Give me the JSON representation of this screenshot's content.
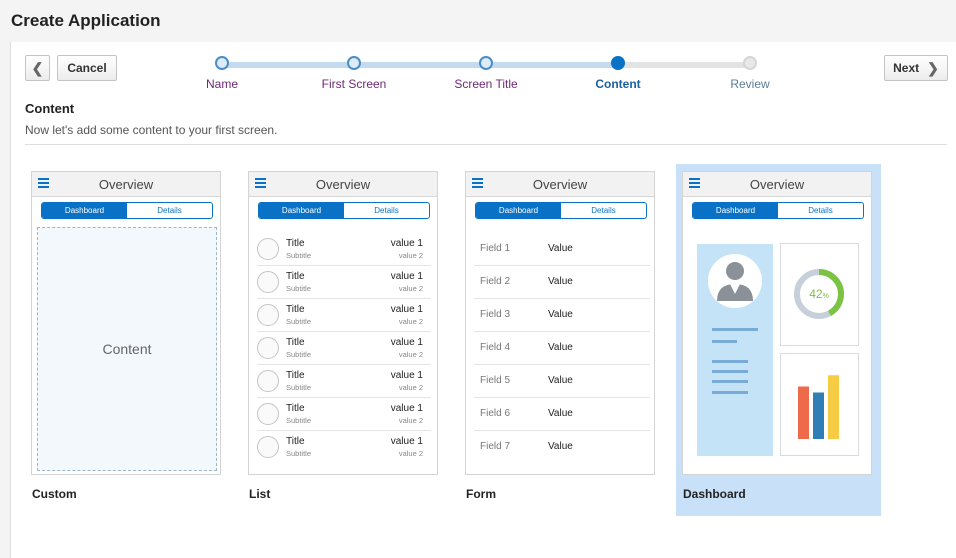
{
  "window": {
    "title": "Create Application"
  },
  "nav": {
    "cancel_label": "Cancel",
    "next_label": "Next",
    "prev_icon": "chevron-left-icon",
    "next_icon": "chevron-right-icon"
  },
  "train": {
    "stops": [
      {
        "label": "Name",
        "state": "visited"
      },
      {
        "label": "First Screen",
        "state": "visited"
      },
      {
        "label": "Screen Title",
        "state": "visited"
      },
      {
        "label": "Content",
        "state": "current"
      },
      {
        "label": "Review",
        "state": "future"
      }
    ]
  },
  "section": {
    "title": "Content",
    "description": "Now let's add some content to your first screen."
  },
  "preview": {
    "header_title": "Overview",
    "tab_primary": "Dashboard",
    "tab_secondary": "Details",
    "menu_icon": "hamburger-menu-icon"
  },
  "templates": [
    {
      "name": "Custom",
      "selected": false
    },
    {
      "name": "List",
      "selected": false
    },
    {
      "name": "Form",
      "selected": false
    },
    {
      "name": "Dashboard",
      "selected": true
    }
  ],
  "custom": {
    "placeholder": "Content"
  },
  "list_rows": [
    {
      "title": "Title",
      "subtitle": "Subtitle",
      "value1": "value 1",
      "value2": "value 2"
    },
    {
      "title": "Title",
      "subtitle": "Subtitle",
      "value1": "value 1",
      "value2": "value 2"
    },
    {
      "title": "Title",
      "subtitle": "Subtitle",
      "value1": "value 1",
      "value2": "value 2"
    },
    {
      "title": "Title",
      "subtitle": "Subtitle",
      "value1": "value 1",
      "value2": "value 2"
    },
    {
      "title": "Title",
      "subtitle": "Subtitle",
      "value1": "value 1",
      "value2": "value 2"
    },
    {
      "title": "Title",
      "subtitle": "Subtitle",
      "value1": "value 1",
      "value2": "value 2"
    },
    {
      "title": "Title",
      "subtitle": "Subtitle",
      "value1": "value 1",
      "value2": "value 2"
    }
  ],
  "form_rows": [
    {
      "label": "Field 1",
      "value": "Value"
    },
    {
      "label": "Field 2",
      "value": "Value"
    },
    {
      "label": "Field 3",
      "value": "Value"
    },
    {
      "label": "Field 4",
      "value": "Value"
    },
    {
      "label": "Field 5",
      "value": "Value"
    },
    {
      "label": "Field 6",
      "value": "Value"
    },
    {
      "label": "Field 7",
      "value": "Value"
    }
  ],
  "dashboard": {
    "avatar_icon": "user-avatar-icon",
    "gauge_value": "42",
    "gauge_unit": "%",
    "gauge_fraction": 0.42,
    "gauge_color": "#7cc243",
    "bars": [
      {
        "value": 0.7,
        "color": "#ef6a4a"
      },
      {
        "value": 0.62,
        "color": "#2f7fb6"
      },
      {
        "value": 0.85,
        "color": "#f6cc45"
      }
    ]
  },
  "colors": {
    "accent": "#0a72c6",
    "selected_bg": "#c8e0f8",
    "visited_label": "#6c2a76"
  }
}
